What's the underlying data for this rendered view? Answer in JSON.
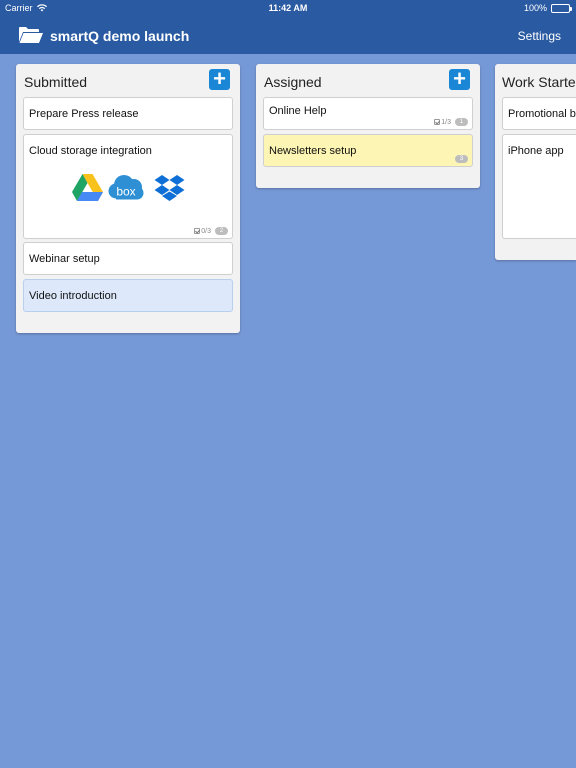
{
  "status_bar": {
    "carrier": "Carrier",
    "time": "11:42 AM",
    "battery": "100%"
  },
  "nav": {
    "title": "smartQ demo launch",
    "settings": "Settings",
    "icon": "folder-icon"
  },
  "columns": [
    {
      "title": "Submitted",
      "add_icon": "+",
      "cards": [
        {
          "title": "Prepare Press release"
        },
        {
          "title": "Cloud storage integration",
          "attachments": [
            "google-drive-icon",
            "box-logo",
            "dropbox-icon"
          ],
          "box_text": "box",
          "checklist": "0/3",
          "comments": "2"
        },
        {
          "title": "Webinar setup"
        },
        {
          "title": "Video introduction",
          "highlight": "#dde9fa"
        }
      ]
    },
    {
      "title": "Assigned",
      "add_icon": "+",
      "cards": [
        {
          "title": "Online  Help",
          "checklist": "1/3",
          "comments": "1"
        },
        {
          "title": "Newsletters setup",
          "highlight": "#fdf5b4",
          "comments": "3"
        }
      ]
    },
    {
      "title": "Work Started",
      "cards": [
        {
          "title": "Promotional banners"
        },
        {
          "title": "iPhone app"
        }
      ]
    }
  ],
  "colors": {
    "nav_bar": "#2a5aa2",
    "board_bg": "#7598d6",
    "add_button": "#1a87d6"
  }
}
